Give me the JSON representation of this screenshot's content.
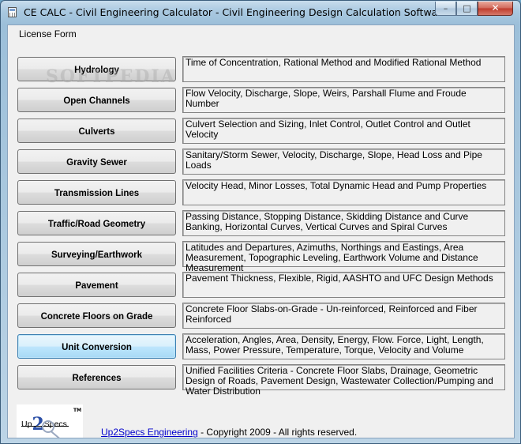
{
  "window": {
    "title": "CE CALC - Civil Engineering Calculator - Civil Engineering Design Calculation Software",
    "controls": {
      "minimize": "–",
      "maximize": "□",
      "close": "✕"
    }
  },
  "menu": {
    "license_form": "License Form"
  },
  "watermark": "SOFTPEDIA",
  "rows": [
    {
      "label": "Hydrology",
      "description": "Time of Concentration, Rational Method and Modified Rational Method"
    },
    {
      "label": "Open Channels",
      "description": "Flow Velocity, Discharge, Slope, Weirs, Parshall Flume and Froude Number"
    },
    {
      "label": "Culverts",
      "description": "Culvert Selection and Sizing, Inlet Control, Outlet Control and Outlet Velocity"
    },
    {
      "label": "Gravity Sewer",
      "description": "Sanitary/Storm Sewer, Velocity, Discharge, Slope, Head Loss and Pipe Loads"
    },
    {
      "label": "Transmission Lines",
      "description": "Velocity Head, Minor Losses, Total Dynamic Head and Pump Properties"
    },
    {
      "label": "Traffic/Road Geometry",
      "description": "Passing Distance, Stopping Distance, Skidding Distance and Curve Banking, Horizontal Curves, Vertical Curves and Spiral Curves"
    },
    {
      "label": "Surveying/Earthwork",
      "description": "Latitudes and Departures, Azimuths, Northings and Eastings, Area Measurement, Topographic Leveling, Earthwork Volume and Distance Measurement"
    },
    {
      "label": "Pavement",
      "description": "Pavement Thickness, Flexible, Rigid, AASHTO and UFC Design Methods"
    },
    {
      "label": "Concrete Floors on Grade",
      "description": "Concrete Floor Slabs-on-Grade - Un-reinforced, Reinforced and Fiber Reinforced"
    },
    {
      "label": "Unit Conversion",
      "description": "Acceleration, Angles, Area, Density, Energy, Flow. Force, Light, Length, Mass, Power Pressure, Temperature, Torque, Velocity and Volume"
    },
    {
      "label": "References",
      "description": "Unified Facilities Criteria - Concrete Floor Slabs, Drainage, Geometric Design of Roads, Pavement Design, Wastewater Collection/Pumping and Water Distribution"
    }
  ],
  "logo": {
    "left": "Up",
    "middle": "2",
    "right": "Specs",
    "tm": "TM"
  },
  "footer": {
    "link": "Up2Specs Engineering",
    "copyright": " - Copyright 2009 - All rights reserved."
  }
}
